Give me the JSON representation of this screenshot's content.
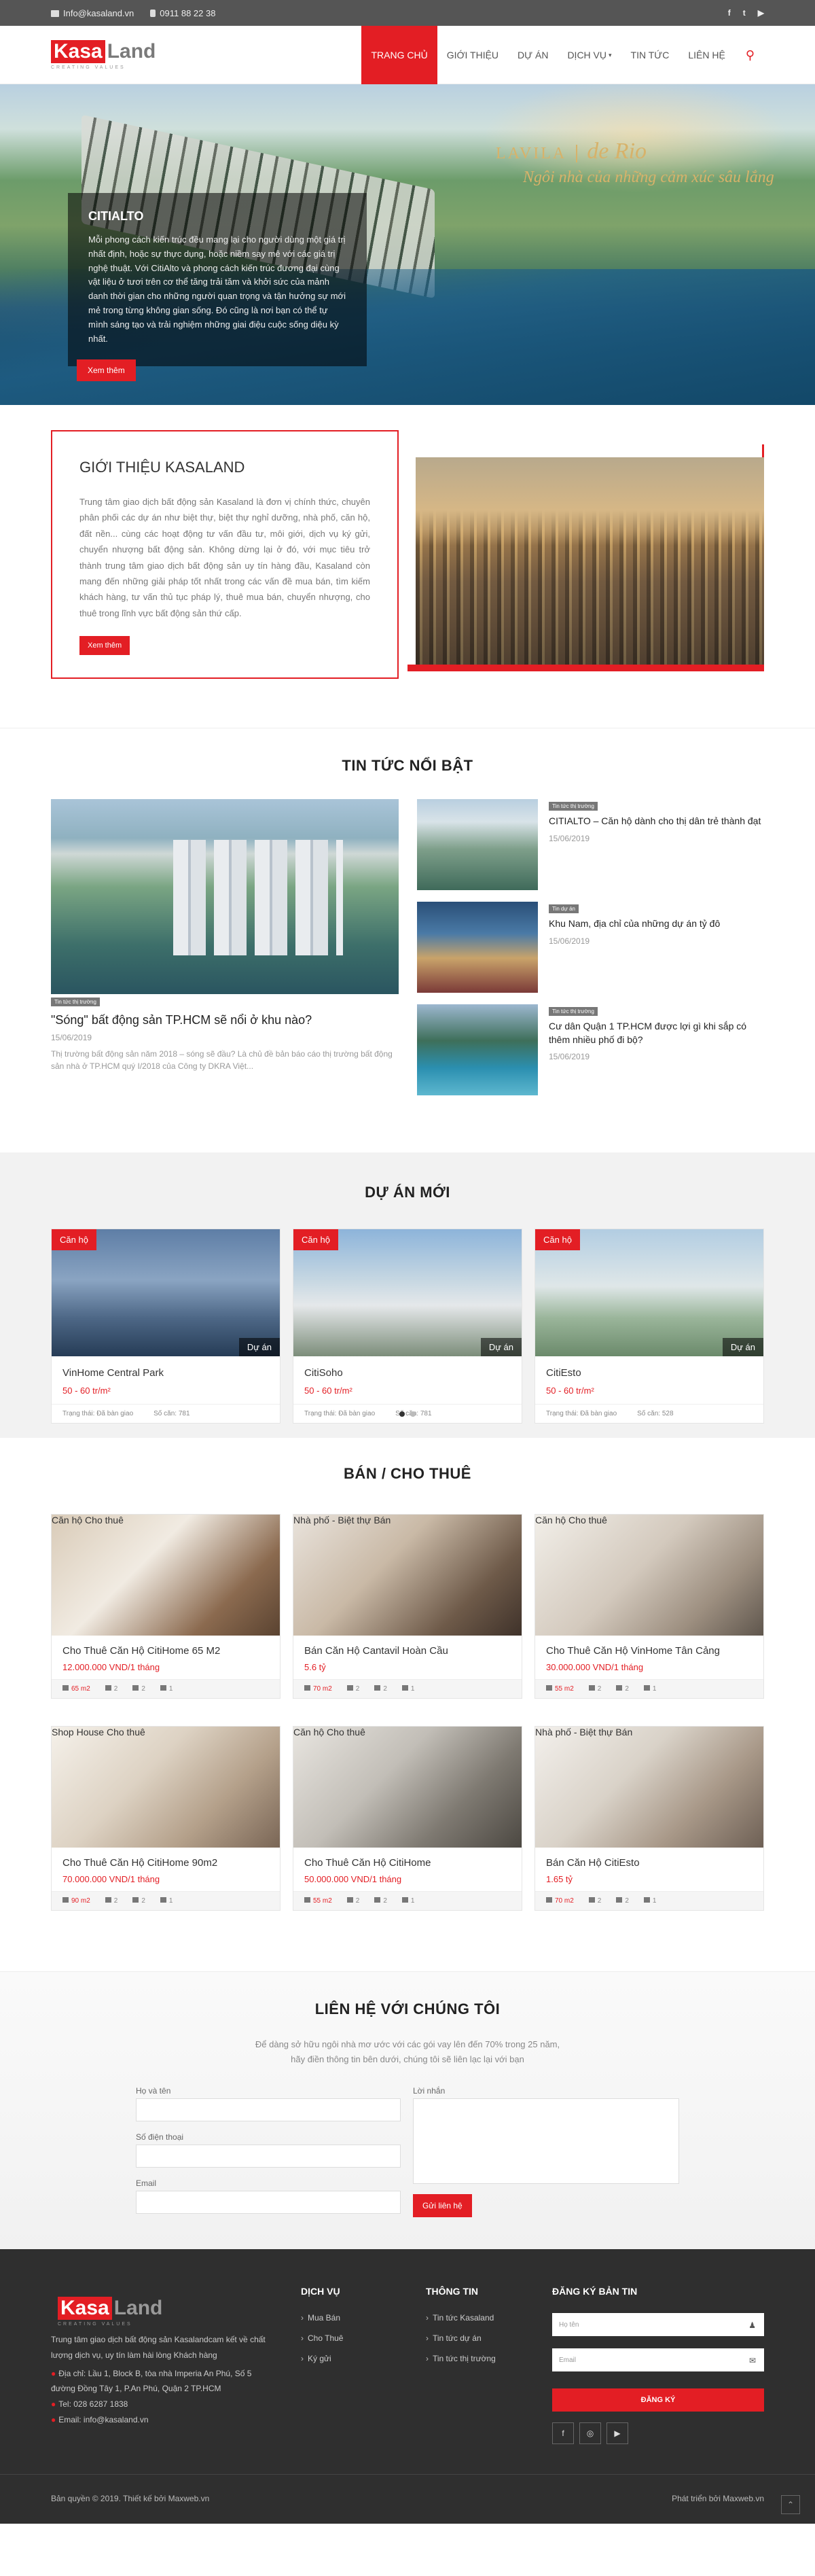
{
  "topbar": {
    "email": "Info@kasaland.vn",
    "phone": "0911 88 22 38",
    "social": [
      "f",
      "t",
      "▶"
    ]
  },
  "logo": {
    "kasa": "Kasa",
    "land": "Land",
    "tagline": "CREATING VALUES"
  },
  "nav": [
    "TRANG CHỦ",
    "GIỚI THIỆU",
    "DỰ ÁN",
    "DỊCH VỤ",
    "TIN TỨC",
    "LIÊN HỆ"
  ],
  "hero": {
    "title": "CITIALTO",
    "text": "Mỗi phong cách kiến trúc đều mang lại cho người dùng một giá trị nhất định, hoặc sự thực dụng, hoặc niềm say mê với các giá trị nghệ thuật. Với CitiAlto và phong cách kiến trúc đương đại cùng vật liệu ở tươi trên cơ thể tăng trải tăm và khởi sức của mảnh danh thời gian cho những người quan trọng và tận hưởng sự mới mẻ trong từng không gian sống. Đó cũng là nơi bạn có thể tự mình sáng tạo và trải nghiệm những giai điệu cuộc sống diệu kỳ nhất.",
    "button": "Xem thêm",
    "brand": {
      "name": "LAVILA",
      "title": "de Rio",
      "slogan": "Ngôi nhà của những cảm xúc sâu lắng"
    }
  },
  "intro": {
    "title": "GIỚI THIỆU KASALAND",
    "text": "Trung tâm giao dịch bất động sản Kasaland là đơn vị chính thức, chuyên phân phối các dự án như biệt thự, biệt thự nghỉ dưỡng, nhà phố, căn hộ, đất nền... cùng các hoạt động tư vấn đầu tư, môi giới, dịch vụ ký gửi, chuyển nhượng bất động sản. Không dừng lại ở đó, với mục tiêu trở thành trung tâm giao dịch bất động sản uy tín hàng đầu, Kasaland còn mang đến những giải pháp tốt nhất trong các vấn đề mua bán, tìm kiếm khách hàng, tư vấn thủ tục pháp lý, thuê mua bán, chuyển nhượng, cho thuê trong lĩnh vực bất động sản thứ cấp.",
    "button": "Xem thêm"
  },
  "news": {
    "title": "TIN TỨC NỔI BẬT",
    "featured": {
      "tag": "Tin tức thị trường",
      "title": "\"Sóng\" bất động sản TP.HCM sẽ nổi ở khu nào?",
      "date": "15/06/2019",
      "excerpt": "Thị trường bất động sản năm 2018 – sóng sẽ đầu? Là chủ đề bản báo cáo thị trường bất động sản nhà ở TP.HCM quý I/2018 của Công ty DKRA Việt..."
    },
    "items": [
      {
        "tag": "Tin tức thị trường",
        "title": "CITIALTO – Căn hộ dành cho thị dân trẻ thành đạt",
        "date": "15/06/2019"
      },
      {
        "tag": "Tin dự án",
        "title": "Khu Nam, địa chỉ của những dự án tỷ đô",
        "date": "15/06/2019"
      },
      {
        "tag": "Tin tức thị trường",
        "title": "Cư dân Quận 1 TP.HCM được lợi gì khi sắp có thêm nhiều phố đi bộ?",
        "date": "15/06/2019"
      }
    ]
  },
  "projects": {
    "title": "DỰ ÁN MỚI",
    "items": [
      {
        "cat": "Căn hộ",
        "type": "Dự án",
        "name": "VinHome Central Park",
        "price": "50 - 60 tr/m²",
        "status": "Trạng thái: Đã bàn giao",
        "units": "Số căn: 781"
      },
      {
        "cat": "Căn hộ",
        "type": "Dự án",
        "name": "CitiSoho",
        "price": "50 - 60 tr/m²",
        "status": "Trạng thái: Đã bàn giao",
        "units": "Số căn: 781"
      },
      {
        "cat": "Căn hộ",
        "type": "Dự án",
        "name": "CitiEsto",
        "price": "50 - 60 tr/m²",
        "status": "Trạng thái: Đã bàn giao",
        "units": "Số căn: 528"
      }
    ]
  },
  "sale": {
    "title": "BÁN / CHO THUÊ",
    "items": [
      {
        "cat": "Căn hộ",
        "type": "Cho thuê",
        "name": "Cho Thuê Căn Hộ CitiHome 65 M2",
        "price": "12.000.000 VND/1 tháng",
        "area": "65 m2",
        "bed": "2",
        "bath": "2",
        "car": "1"
      },
      {
        "cat": "Nhà phố - Biệt thự",
        "type": "Bán",
        "name": "Bán Căn Hộ Cantavil Hoàn Cầu",
        "price": "5.6 tỷ",
        "area": "70 m2",
        "bed": "2",
        "bath": "2",
        "car": "1"
      },
      {
        "cat": "Căn hộ",
        "type": "Cho thuê",
        "name": "Cho Thuê Căn Hộ VinHome Tân Cảng",
        "price": "30.000.000 VND/1 tháng",
        "area": "55 m2",
        "bed": "2",
        "bath": "2",
        "car": "1"
      },
      {
        "cat": "Shop House",
        "type": "Cho thuê",
        "name": "Cho Thuê Căn Hộ CitiHome 90m2",
        "price": "70.000.000 VND/1 tháng",
        "area": "90 m2",
        "bed": "2",
        "bath": "2",
        "car": "1"
      },
      {
        "cat": "Căn hộ",
        "type": "Cho thuê",
        "name": "Cho Thuê Căn Hộ CitiHome",
        "price": "50.000.000 VND/1 tháng",
        "area": "55 m2",
        "bed": "2",
        "bath": "2",
        "car": "1"
      },
      {
        "cat": "Nhà phố - Biệt thự",
        "type": "Bán",
        "name": "Bán Căn Hộ CitiEsto",
        "price": "1.65 tỷ",
        "area": "70 m2",
        "bed": "2",
        "bath": "2",
        "car": "1"
      }
    ]
  },
  "contact": {
    "title": "LIÊN HỆ VỚI CHÚNG TÔI",
    "lead1": "Để dàng sở hữu ngôi nhà mơ ước với các gói vay lên đến 70% trong 25 năm,",
    "lead2": "hãy điền thông tin bên dưới, chúng tôi sẽ liên lạc lại với bạn",
    "name_label": "Họ và tên",
    "phone_label": "Số điện thoại",
    "email_label": "Email",
    "message_label": "Lời nhắn",
    "submit": "Gửi liên hệ"
  },
  "footer": {
    "about": "Trung tâm giao dịch bất động sản Kasalandcam kết về chất lượng dịch vụ, uy tín làm hài lòng Khách hàng",
    "address": "Địa chỉ: Lầu 1, Block B, tòa nhà Imperia An Phú, Số 5 đường Đồng Tây 1, P.An Phú, Quận 2 TP.HCM",
    "tel": "Tel: 028 6287 1838",
    "email": "Email: info@kasaland.vn",
    "services_title": "DỊCH VỤ",
    "services": [
      "Mua Bán",
      "Cho Thuê",
      "Ký gửi"
    ],
    "info_title": "THÔNG TIN",
    "info": [
      "Tin tức Kasaland",
      "Tin tức dự án",
      "Tin tức thị trường"
    ],
    "subscribe_title": "ĐĂNG KÝ BẢN TIN",
    "name_placeholder": "Họ tên",
    "email_placeholder": "Email",
    "subscribe_button": "ĐĂNG KÝ",
    "social": [
      "f",
      "◎",
      "▶"
    ],
    "copyright": "Bản quyền © 2019. Thiết kế bởi Maxweb.vn",
    "developer": "Phát triển bởi Maxweb.vn"
  }
}
